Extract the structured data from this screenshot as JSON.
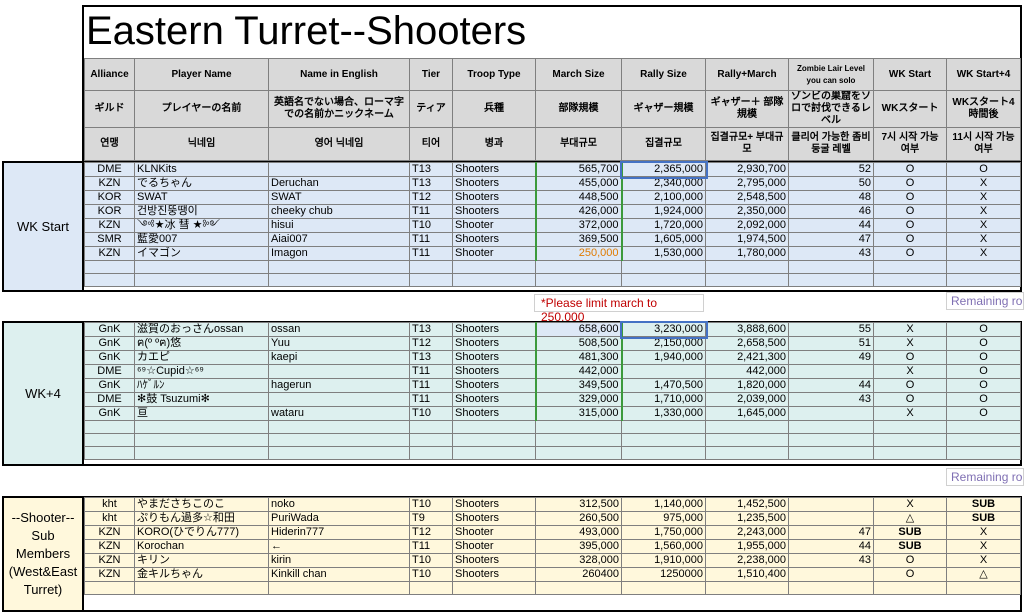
{
  "title": "Eastern Turret--Shooters",
  "headers": {
    "en": [
      "Alliance",
      "Player Name",
      "Name in English",
      "Tier",
      "Troop Type",
      "March Size",
      "Rally Size",
      "Rally+March",
      "Zombie Lair Level you can solo",
      "WK Start",
      "WK Start+4"
    ],
    "jp": [
      "ギルド",
      "プレイヤーの名前",
      "英語名でない場合、ローマ字での名前かニックネーム",
      "ティア",
      "兵種",
      "部隊規模",
      "ギャザー規模",
      "ギャザー＋ 部隊規模",
      "ゾンビの巣窟をソロで討伐できるレベル",
      "WKスタート",
      "WKスタート4時間後"
    ],
    "kr": [
      "연맹",
      "닉네임",
      "영어 닉네임",
      "티어",
      "병과",
      "부대규모",
      "집결규모",
      "집결규모+ 부대규모",
      "클리어 가능한 좀비둥굴 레벨",
      "7시 시작 가능 여부",
      "11시 시작 가능 여부"
    ]
  },
  "groups": {
    "wk_start": "WK Start",
    "wk4": "WK+4",
    "sub": "--Shooter-- Sub Members (West&East Turret)"
  },
  "note": "*Please limit march to 250,000",
  "remaining1": "Remaining ro",
  "remaining2": "Remaining ro",
  "wk_start_rows": [
    {
      "alliance": "DME",
      "player": "KLNKits",
      "english": "",
      "tier": "T13",
      "troop": "Shooters",
      "march": "565,700",
      "rally": "2,365,000",
      "rm": "2,930,700",
      "lair": "52",
      "wk": "O",
      "wk4": "O"
    },
    {
      "alliance": "KZN",
      "player": "でるちゃん",
      "english": "Deruchan",
      "tier": "T13",
      "troop": "Shooters",
      "march": "455,000",
      "rally": "2,340,000",
      "rm": "2,795,000",
      "lair": "50",
      "wk": "O",
      "wk4": "X"
    },
    {
      "alliance": "KOR",
      "player": "SWAT",
      "english": "SWAT",
      "tier": "T12",
      "troop": "Shooters",
      "march": "448,500",
      "rally": "2,100,000",
      "rm": "2,548,500",
      "lair": "48",
      "wk": "O",
      "wk4": "X"
    },
    {
      "alliance": "KOR",
      "player": "건방진뚱땡이",
      "english": "cheeky chub",
      "tier": "T11",
      "troop": "Shooters",
      "march": "426,000",
      "rally": "1,924,000",
      "rm": "2,350,000",
      "lair": "46",
      "wk": "O",
      "wk4": "X"
    },
    {
      "alliance": "KZN",
      "player": "༺★冰 彗 ★༻",
      "english": "hisui",
      "tier": "T10",
      "troop": "Shooter",
      "march": "372,000",
      "rally": "1,720,000",
      "rm": "2,092,000",
      "lair": "44",
      "wk": "O",
      "wk4": "X"
    },
    {
      "alliance": "SMR",
      "player": "藍愛007",
      "english": "Aiai007",
      "tier": "T11",
      "troop": "Shooters",
      "march": "369,500",
      "rally": "1,605,000",
      "rm": "1,974,500",
      "lair": "47",
      "wk": "O",
      "wk4": "X"
    },
    {
      "alliance": "KZN",
      "player": "イマゴン",
      "english": "Imagon",
      "tier": "T11",
      "troop": "Shooter",
      "march": "250,000",
      "rally": "1,530,000",
      "rm": "1,780,000",
      "lair": "43",
      "wk": "O",
      "wk4": "X"
    }
  ],
  "wk4_rows": [
    {
      "alliance": "GnK",
      "player": "滋賀のおっさんossan",
      "english": "ossan",
      "tier": "T13",
      "troop": "Shooters",
      "march": "658,600",
      "rally": "3,230,000",
      "rm": "3,888,600",
      "lair": "55",
      "wk": "X",
      "wk4": "O"
    },
    {
      "alliance": "GnK",
      "player": "ฅ(º ºฅ)悠",
      "english": "Yuu",
      "tier": "T12",
      "troop": "Shooters",
      "march": "508,500",
      "rally": "2,150,000",
      "rm": "2,658,500",
      "lair": "51",
      "wk": "X",
      "wk4": "O"
    },
    {
      "alliance": "GnK",
      "player": "カエピ",
      "english": "kaepi",
      "tier": "T13",
      "troop": "Shooters",
      "march": "481,300",
      "rally": "1,940,000",
      "rm": "2,421,300",
      "lair": "49",
      "wk": "O",
      "wk4": "O"
    },
    {
      "alliance": "DME",
      "player": "⁶⁹☆Cupid☆⁶⁹",
      "english": "",
      "tier": "T11",
      "troop": "Shooters",
      "march": "442,000",
      "rally": "",
      "rm": "442,000",
      "lair": "",
      "wk": "X",
      "wk4": "O"
    },
    {
      "alliance": "GnK",
      "player": "ﾊｹﾞﾙﾝ",
      "english": "hagerun",
      "tier": "T11",
      "troop": "Shooters",
      "march": "349,500",
      "rally": "1,470,500",
      "rm": "1,820,000",
      "lair": "44",
      "wk": "O",
      "wk4": "O"
    },
    {
      "alliance": "DME",
      "player": "✻鼓 Tsuzumi✻",
      "english": "",
      "tier": "T11",
      "troop": "Shooters",
      "march": "329,000",
      "rally": "1,710,000",
      "rm": "2,039,000",
      "lair": "43",
      "wk": "O",
      "wk4": "O"
    },
    {
      "alliance": "GnK",
      "player": "亘",
      "english": "wataru",
      "tier": "T10",
      "troop": "Shooters",
      "march": "315,000",
      "rally": "1,330,000",
      "rm": "1,645,000",
      "lair": "",
      "wk": "X",
      "wk4": "O"
    }
  ],
  "sub_rows": [
    {
      "alliance": "kht",
      "player": "やまださちこのこ",
      "english": "noko",
      "tier": "T10",
      "troop": "Shooters",
      "march": "312,500",
      "rally": "1,140,000",
      "rm": "1,452,500",
      "lair": "",
      "wk": "X",
      "wk4": "SUB"
    },
    {
      "alliance": "kht",
      "player": "ぷりもん過多☆和田",
      "english": "PuriWada",
      "tier": "T9",
      "troop": "Shooters",
      "march": "260,500",
      "rally": "975,000",
      "rm": "1,235,500",
      "lair": "",
      "wk": "△",
      "wk4": "SUB"
    },
    {
      "alliance": "KZN",
      "player": "KORO(ひでりん777)",
      "english": "Hiderin777",
      "tier": "T12",
      "troop": "Shooter",
      "march": "493,000",
      "rally": "1,750,000",
      "rm": "2,243,000",
      "lair": "47",
      "wk": "SUB",
      "wk4": "X"
    },
    {
      "alliance": "KZN",
      "player": "Korochan",
      "english": "←",
      "tier": "T11",
      "troop": "Shooter",
      "march": "395,000",
      "rally": "1,560,000",
      "rm": "1,955,000",
      "lair": "44",
      "wk": "SUB",
      "wk4": "X"
    },
    {
      "alliance": "KZN",
      "player": "キリン",
      "english": "kirin",
      "tier": "T10",
      "troop": "Shooters",
      "march": "328,000",
      "rally": "1,910,000",
      "rm": "2,238,000",
      "lair": "43",
      "wk": "O",
      "wk4": "X"
    },
    {
      "alliance": "KZN",
      "player": "金キルちゃん",
      "english": "Kinkill chan",
      "tier": "T10",
      "troop": "Shooters",
      "march": "260400",
      "rally": "1250000",
      "rm": "1,510,400",
      "lair": "",
      "wk": "O",
      "wk4": "△"
    }
  ]
}
